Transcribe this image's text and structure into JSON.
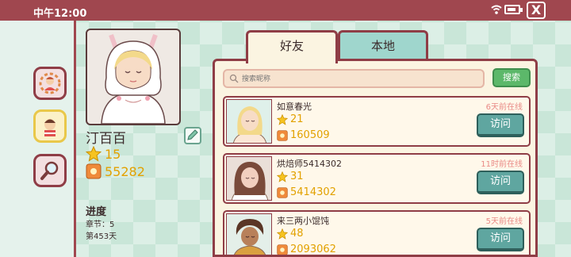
{
  "status_bar": {
    "time": "中午12:00",
    "close_label": "X"
  },
  "profile": {
    "name": "汀百百",
    "level": "15",
    "points": "55282",
    "progress_title": "进度",
    "chapter": "章节：5",
    "day": "第453天"
  },
  "tabs": {
    "friends": "好友",
    "local": "本地"
  },
  "search": {
    "placeholder": "搜索昵称",
    "button": "搜索"
  },
  "friends": [
    {
      "name": "如意春光",
      "last_online": "6天前在线",
      "level": "21",
      "points": "160509",
      "visit": "访问"
    },
    {
      "name": "烘焙师5414302",
      "last_online": "11时前在线",
      "level": "31",
      "points": "5414302",
      "visit": "访问"
    },
    {
      "name": "来三两小馄饨",
      "last_online": "5天前在线",
      "level": "48",
      "points": "2093062",
      "visit": "访问"
    }
  ],
  "colors": {
    "accent": "#a0474f",
    "button_green": "#5cb86a",
    "button_teal": "#5fa6a0",
    "gold": "#e2a100"
  }
}
